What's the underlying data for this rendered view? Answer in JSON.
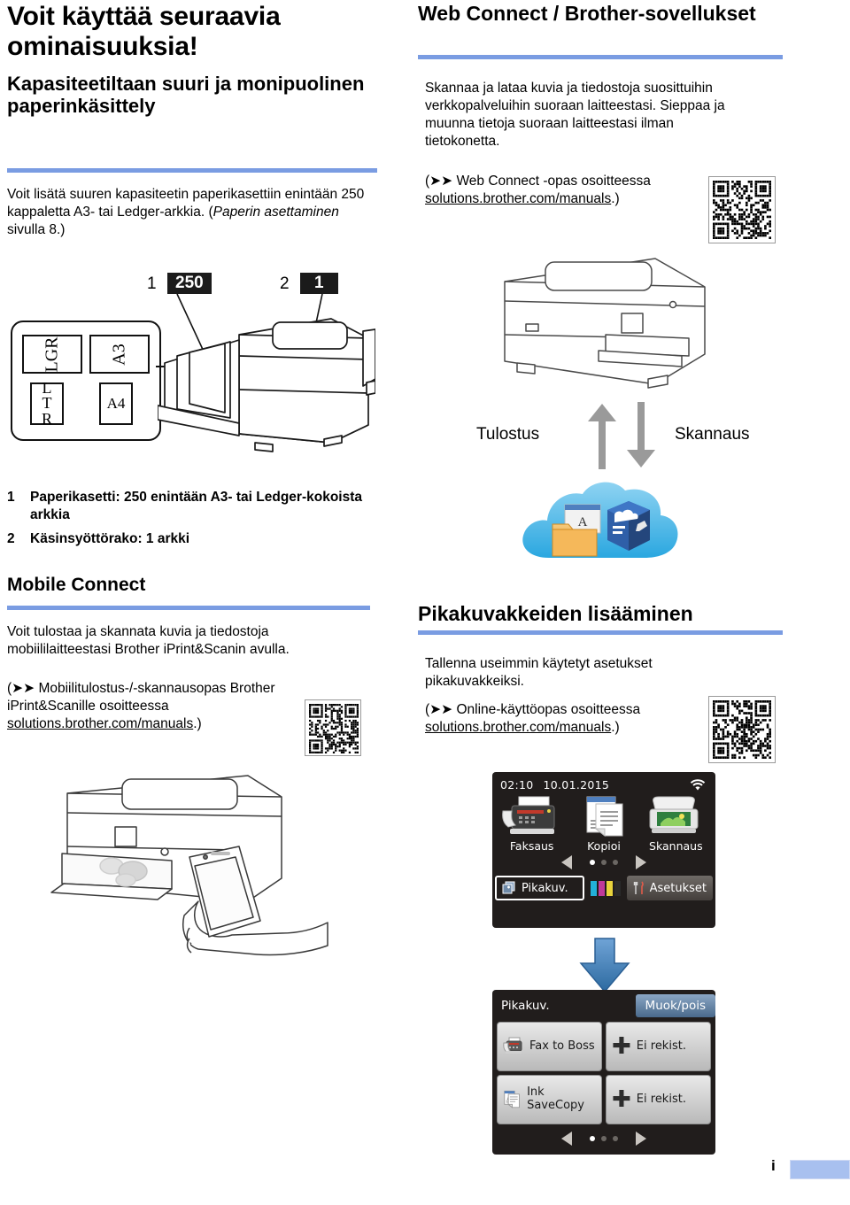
{
  "colors": {
    "accent_rule": "#7a9ce2",
    "footer_bar": "#a8c0ef",
    "badge_bg": "#1b1b1b",
    "arrow_gray": "#9a9a9a",
    "arrow_blue": "#3f7cb8",
    "lcd_bg": "#211d1c"
  },
  "left": {
    "page_title": "Voit käyttää seuraavia ominaisuuksia!",
    "section1": {
      "heading": "Kapasiteetiltaan suuri ja monipuolinen paperinkäsittely",
      "body_1": "Voit lisätä suuren kapasiteetin paperikasettiin enintään 250 kappaletta A3- tai Ledger-arkkia. (",
      "body_italic": "Paperin asettaminen",
      "body_2": " sivulla 8.)"
    },
    "diagram": {
      "callout_1_num": "1",
      "callout_1_badge": "250",
      "callout_2_num": "2",
      "callout_2_badge": "1",
      "paper_sizes": [
        "LGR",
        "A3",
        "LTR",
        "A4"
      ]
    },
    "specs": [
      {
        "num": "1",
        "text": "Paperikasetti: 250 enintään A3- tai Ledger-kokoista arkkia"
      },
      {
        "num": "2",
        "text": "Käsinsyöttörako: 1 arkki"
      }
    ],
    "section2": {
      "heading": "Mobile Connect",
      "body": "Voit tulostaa ja skannata kuvia ja tiedostoja mobiililaitteestasi Brother iPrint&Scanin avulla.",
      "ref_open": "(",
      "ref_arrows": "➤➤",
      "ref_text_1": " Mobiilitulostus-/-skannausopas Brother iPrint&Scanille osoitteessa ",
      "ref_link": "solutions.brother.com/manuals",
      "ref_close": ".)"
    }
  },
  "right": {
    "section1": {
      "heading": "Web Connect / Brother-sovellukset",
      "body": "Skannaa ja lataa kuvia ja tiedostoja suosittuihin verkkopalveluihin suoraan laitteestasi. Sieppaa ja muunna tietoja suoraan laitteestasi ilman tietokonetta.",
      "ref_open": "(",
      "ref_arrows": "➤➤",
      "ref_text_1": " Web Connect -opas osoitteessa ",
      "ref_link": "solutions.brother.com/manuals",
      "ref_close": ".)"
    },
    "flow": {
      "label_print": "Tulostus",
      "label_scan": "Skannaus"
    },
    "section2": {
      "heading": "Pikakuvakkeiden lisääminen",
      "body": "Tallenna useimmin käytetyt asetukset pikakuvakkeiksi.",
      "ref_open": "(",
      "ref_arrows": "➤➤",
      "ref_text_1": " Online-käyttöopas osoitteessa ",
      "ref_link": "solutions.brother.com/manuals",
      "ref_close": ".)"
    },
    "lcd_home": {
      "time": "02:10",
      "date": "10.01.2015",
      "tiles": [
        {
          "label": "Faksaus",
          "icon": "fax-icon"
        },
        {
          "label": "Kopioi",
          "icon": "copy-icon"
        },
        {
          "label": "Skannaus",
          "icon": "scan-icon"
        }
      ],
      "shortcut_button": "Pikakuv.",
      "settings_button": "Asetukset",
      "page_dots": 3,
      "active_dot": 1
    },
    "lcd_shortcuts": {
      "title": "Pikakuv.",
      "edit_button": "Muok/pois",
      "buttons": [
        {
          "label": "Fax to Boss",
          "icon": "fax-icon",
          "empty": false
        },
        {
          "label": "Ei rekist.",
          "icon": "plus-icon",
          "empty": true
        },
        {
          "label": "Ink SaveCopy",
          "icon": "copy-icon",
          "empty": false
        },
        {
          "label": "Ei rekist.",
          "icon": "plus-icon",
          "empty": true
        }
      ],
      "page_dots": 3,
      "active_dot": 1
    }
  },
  "footer": {
    "folio": "i"
  }
}
